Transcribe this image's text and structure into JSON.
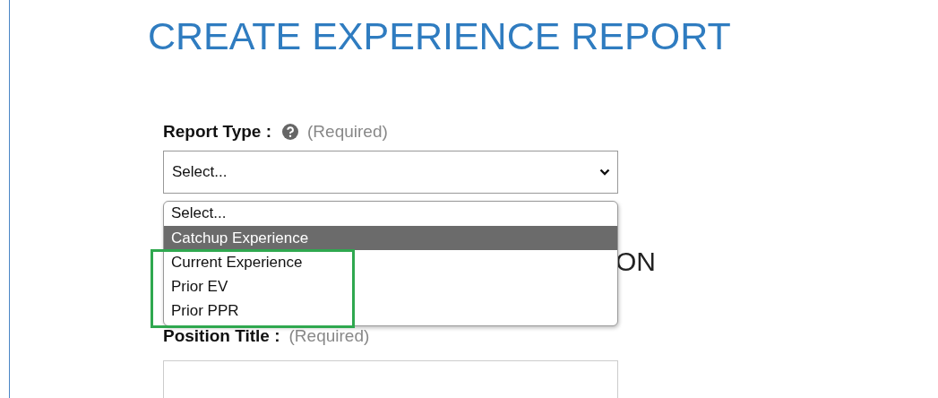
{
  "title": "CREATE EXPERIENCE REPORT",
  "report_type": {
    "label": "Report Type :",
    "hint": "(Required)",
    "select": {
      "value": "Select...",
      "expanded": true
    },
    "options": [
      {
        "label": "Select...",
        "selected": false
      },
      {
        "label": "Catchup Experience",
        "selected": true
      },
      {
        "label": "Current Experience",
        "selected": false
      },
      {
        "label": "Prior EV",
        "selected": false
      },
      {
        "label": "Prior PPR",
        "selected": false
      }
    ]
  },
  "section_heading": "ON",
  "position_title": {
    "label": "Position Title :",
    "hint": "(Required)"
  },
  "highlight": {
    "color": "#2fa84f"
  }
}
